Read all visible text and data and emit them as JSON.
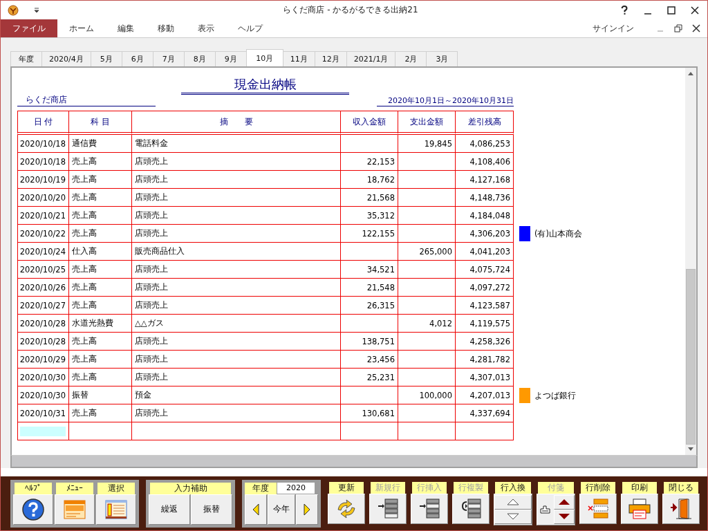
{
  "window": {
    "title": "らくだ商店 - かるがるできる出納21",
    "sign_in": "サインイン"
  },
  "menu": [
    {
      "label": "ファイル",
      "selected": true
    },
    {
      "label": "ホーム",
      "selected": false
    },
    {
      "label": "編集",
      "selected": false
    },
    {
      "label": "移動",
      "selected": false
    },
    {
      "label": "表示",
      "selected": false
    },
    {
      "label": "ヘルプ",
      "selected": false
    }
  ],
  "tabs": [
    {
      "label": "年度",
      "selected": false
    },
    {
      "label": "2020/4月",
      "selected": false
    },
    {
      "label": "5月",
      "selected": false
    },
    {
      "label": "6月",
      "selected": false
    },
    {
      "label": "7月",
      "selected": false
    },
    {
      "label": "8月",
      "selected": false
    },
    {
      "label": "9月",
      "selected": false
    },
    {
      "label": "10月",
      "selected": true
    },
    {
      "label": "11月",
      "selected": false
    },
    {
      "label": "12月",
      "selected": false
    },
    {
      "label": "2021/1月",
      "selected": false
    },
    {
      "label": "2月",
      "selected": false
    },
    {
      "label": "3月",
      "selected": false
    }
  ],
  "ledger": {
    "title": "現金出納帳",
    "shop": "らくだ商店",
    "period": "2020年10月1日～2020年10月31日",
    "columns": [
      "日 付",
      "科 目",
      "摘　　要",
      "収入金額",
      "支出金額",
      "差引残高"
    ],
    "rows": [
      {
        "date": "2020/10/18",
        "account": "通信費",
        "description": "電話料金",
        "income": "",
        "expense": "19,845",
        "balance": "4,086,253"
      },
      {
        "date": "2020/10/18",
        "account": "売上高",
        "description": "店頭売上",
        "income": "22,153",
        "expense": "",
        "balance": "4,108,406"
      },
      {
        "date": "2020/10/19",
        "account": "売上高",
        "description": "店頭売上",
        "income": "18,762",
        "expense": "",
        "balance": "4,127,168"
      },
      {
        "date": "2020/10/20",
        "account": "売上高",
        "description": "店頭売上",
        "income": "21,568",
        "expense": "",
        "balance": "4,148,736"
      },
      {
        "date": "2020/10/21",
        "account": "売上高",
        "description": "店頭売上",
        "income": "35,312",
        "expense": "",
        "balance": "4,184,048"
      },
      {
        "date": "2020/10/22",
        "account": "売上高",
        "description": "店頭売上",
        "income": "122,155",
        "expense": "",
        "balance": "4,306,203",
        "note": {
          "text": "(有)山本商会",
          "color": "#0000ff"
        }
      },
      {
        "date": "2020/10/24",
        "account": "仕入高",
        "description": "販売商品仕入",
        "income": "",
        "expense": "265,000",
        "balance": "4,041,203"
      },
      {
        "date": "2020/10/25",
        "account": "売上高",
        "description": "店頭売上",
        "income": "34,521",
        "expense": "",
        "balance": "4,075,724"
      },
      {
        "date": "2020/10/26",
        "account": "売上高",
        "description": "店頭売上",
        "income": "21,548",
        "expense": "",
        "balance": "4,097,272"
      },
      {
        "date": "2020/10/27",
        "account": "売上高",
        "description": "店頭売上",
        "income": "26,315",
        "expense": "",
        "balance": "4,123,587"
      },
      {
        "date": "2020/10/28",
        "account": "水道光熱費",
        "description": "△△ガス",
        "income": "",
        "expense": "4,012",
        "balance": "4,119,575"
      },
      {
        "date": "2020/10/28",
        "account": "売上高",
        "description": "店頭売上",
        "income": "138,751",
        "expense": "",
        "balance": "4,258,326"
      },
      {
        "date": "2020/10/29",
        "account": "売上高",
        "description": "店頭売上",
        "income": "23,456",
        "expense": "",
        "balance": "4,281,782"
      },
      {
        "date": "2020/10/30",
        "account": "売上高",
        "description": "店頭売上",
        "income": "25,231",
        "expense": "",
        "balance": "4,307,013"
      },
      {
        "date": "2020/10/30",
        "account": "振替",
        "description": "預金",
        "income": "",
        "expense": "100,000",
        "balance": "4,207,013",
        "note": {
          "text": "よつば銀行",
          "color": "#ff9900"
        }
      },
      {
        "date": "2020/10/31",
        "account": "売上高",
        "description": "店頭売上",
        "income": "130,681",
        "expense": "",
        "balance": "4,337,694"
      }
    ]
  },
  "toolbar": [
    {
      "kind": "panel",
      "tools": [
        {
          "kind": "help",
          "label": "ﾍﾙﾌﾟ",
          "disabled": false
        },
        {
          "kind": "menu",
          "label": "ﾒﾆｭｰ",
          "disabled": false
        },
        {
          "kind": "select",
          "label": "選択",
          "disabled": false
        }
      ]
    },
    {
      "kind": "assist",
      "label": "入力補助",
      "buttons": [
        "繰返",
        "振替"
      ]
    },
    {
      "kind": "year",
      "label": "年度",
      "value": "2020",
      "button": "今年"
    },
    {
      "kind": "strip",
      "tools": [
        {
          "kind": "refresh",
          "label": "更新",
          "disabled": false
        },
        {
          "kind": "newrow",
          "label": "新規行",
          "disabled": true
        },
        {
          "kind": "insert",
          "label": "行挿入",
          "disabled": true
        },
        {
          "kind": "copy",
          "label": "行複製",
          "disabled": true
        },
        {
          "kind": "swap",
          "label": "行入換",
          "disabled": false
        },
        {
          "kind": "sticky",
          "label": "付箋",
          "disabled": true
        },
        {
          "kind": "delete",
          "label": "行削除",
          "disabled": false
        },
        {
          "kind": "print",
          "label": "印刷",
          "disabled": false
        },
        {
          "kind": "close",
          "label": "閉じる",
          "disabled": false
        }
      ]
    }
  ]
}
